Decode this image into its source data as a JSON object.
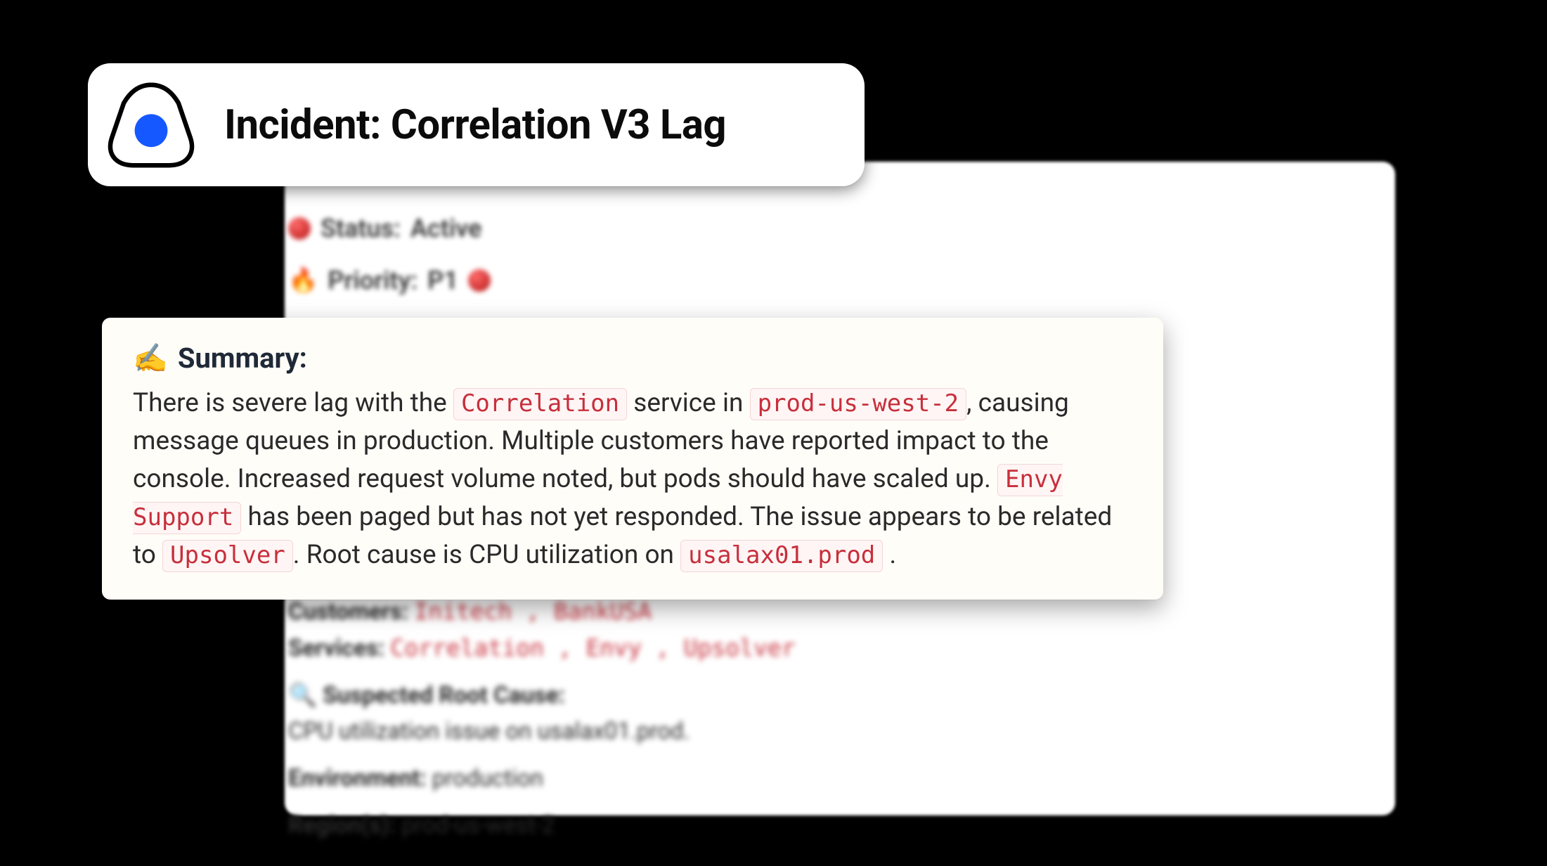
{
  "header": {
    "title": "Incident: Correlation V3 Lag"
  },
  "meta": {
    "status_label": "Status:",
    "status_value": "Active",
    "priority_label": "Priority:",
    "priority_value": "P1"
  },
  "summary": {
    "heading": "Summary:",
    "text_parts": {
      "t1": "There is severe lag with the ",
      "code1": "Correlation",
      "t2": " service in ",
      "code2": "prod-us-west-2",
      "t3": ", causing message queues in production. Multiple customers have reported impact to the console. Increased request volume noted, but pods should have scaled up. ",
      "code3": "Envy Support",
      "t4": " has been paged but has not yet responded. The issue appears to be related to ",
      "code4": "Upsolver",
      "t5": ". Root cause is CPU utilization on ",
      "code5": "usalax01.prod",
      "t6": " ."
    }
  },
  "details": {
    "customers_label": "Customers:",
    "customers_value": "Initech , BankUSA",
    "services_label": "Services:",
    "services_value": "Correlation , Envy , Upsolver",
    "root_cause_label": "Suspected Root Cause:",
    "root_cause_value": "CPU utilization issue on usalax01.prod.",
    "environment_label": "Environment:",
    "environment_value": "production",
    "region_label": "Region(s):",
    "region_value": "prod-us-west-2"
  },
  "icons": {
    "writing_hand": "✍️",
    "flame": "🔥",
    "magnifier": "🔍"
  }
}
